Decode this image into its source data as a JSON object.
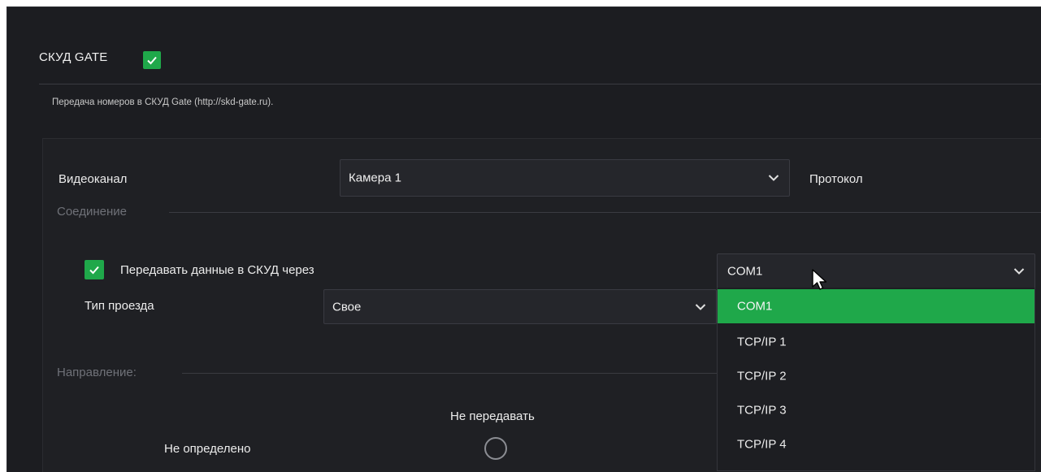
{
  "header": {
    "title": "СКУД GATE",
    "enabled": true,
    "description": "Передача номеров в СКУД Gate (http://skd-gate.ru)."
  },
  "video": {
    "label": "Видеоканал",
    "selected": "Камера 1",
    "protocol_label": "Протокол"
  },
  "connection": {
    "section_label": "Соединение",
    "transmit_label": "Передавать данные в СКУД через",
    "transmit_checked": true,
    "port_selected": "COM1",
    "port_options": [
      "COM1",
      "TCP/IP 1",
      "TCP/IP 2",
      "TCP/IP 3",
      "TCP/IP 4"
    ]
  },
  "passage": {
    "label": "Тип проезда",
    "selected": "Свое"
  },
  "direction": {
    "section_label": "Направление:",
    "column_label": "Не передавать",
    "row_label": "Не определено"
  },
  "colors": {
    "accent": "#1fa84a",
    "background": "#1c1d21"
  }
}
